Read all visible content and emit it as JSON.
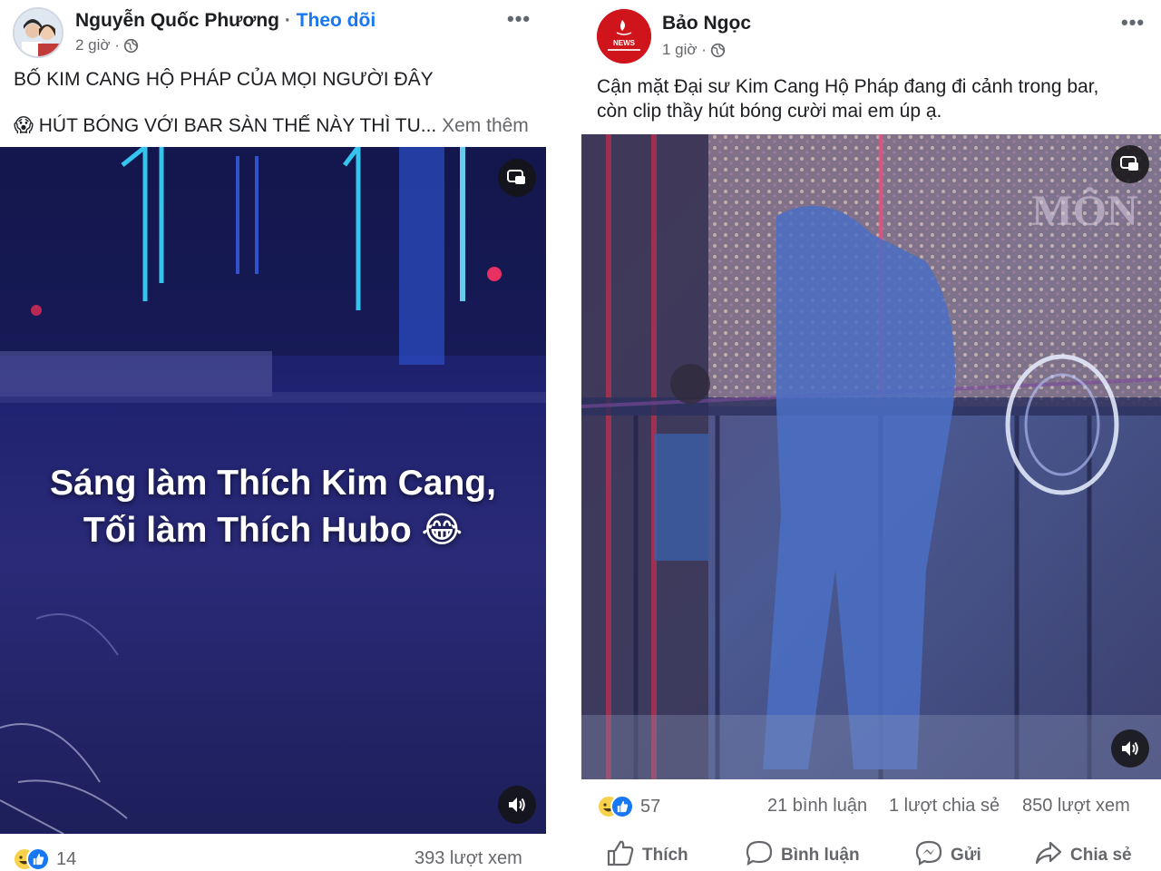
{
  "left_post": {
    "author": "Nguyễn Quốc Phương",
    "separator": "·",
    "follow_label": "Theo dõi",
    "time": "2 giờ ·",
    "caption_line1": "BỐ KIM CANG HỘ PHÁP CỦA MỌI NGƯỜI ĐÂY",
    "caption_line2_emoji": "😱",
    "caption_line2": "HÚT BÓNG VỚI BAR SÀN THẾ NÀY THÌ TU...",
    "see_more": "Xem thêm",
    "video_overlay_line1": "Sáng làm Thích Kim Cang,",
    "video_overlay_line2": "Tối làm Thích Hubo 😂",
    "reaction_count": "14",
    "views": "393 lượt xem"
  },
  "right_post": {
    "author": "Bảo Ngọc",
    "avatar_text": "NEWS",
    "time": "1 giờ ·",
    "caption_line1": "Cận mặt Đại sư Kim Cang Hộ Pháp đang đi cảnh trong bar,",
    "caption_line2": "còn clip thầy hút bóng cười mai em úp ạ.",
    "reaction_count": "57",
    "comments": "21 bình luận",
    "shares": "1 lượt chia sẻ",
    "views": "850 lượt xem",
    "actions": {
      "like": "Thích",
      "comment": "Bình luận",
      "send": "Gửi",
      "share": "Chia sẻ"
    }
  },
  "more_icon": "•••",
  "icons": [
    "globe-icon",
    "more-icon",
    "pip-icon",
    "sound-icon",
    "haha-icon",
    "like-icon",
    "thumbs-up-icon",
    "comment-icon",
    "messenger-icon",
    "share-icon"
  ],
  "colors": {
    "accent": "#1877f2",
    "muted": "#65676b",
    "video_bg": "#1b1d6b"
  }
}
